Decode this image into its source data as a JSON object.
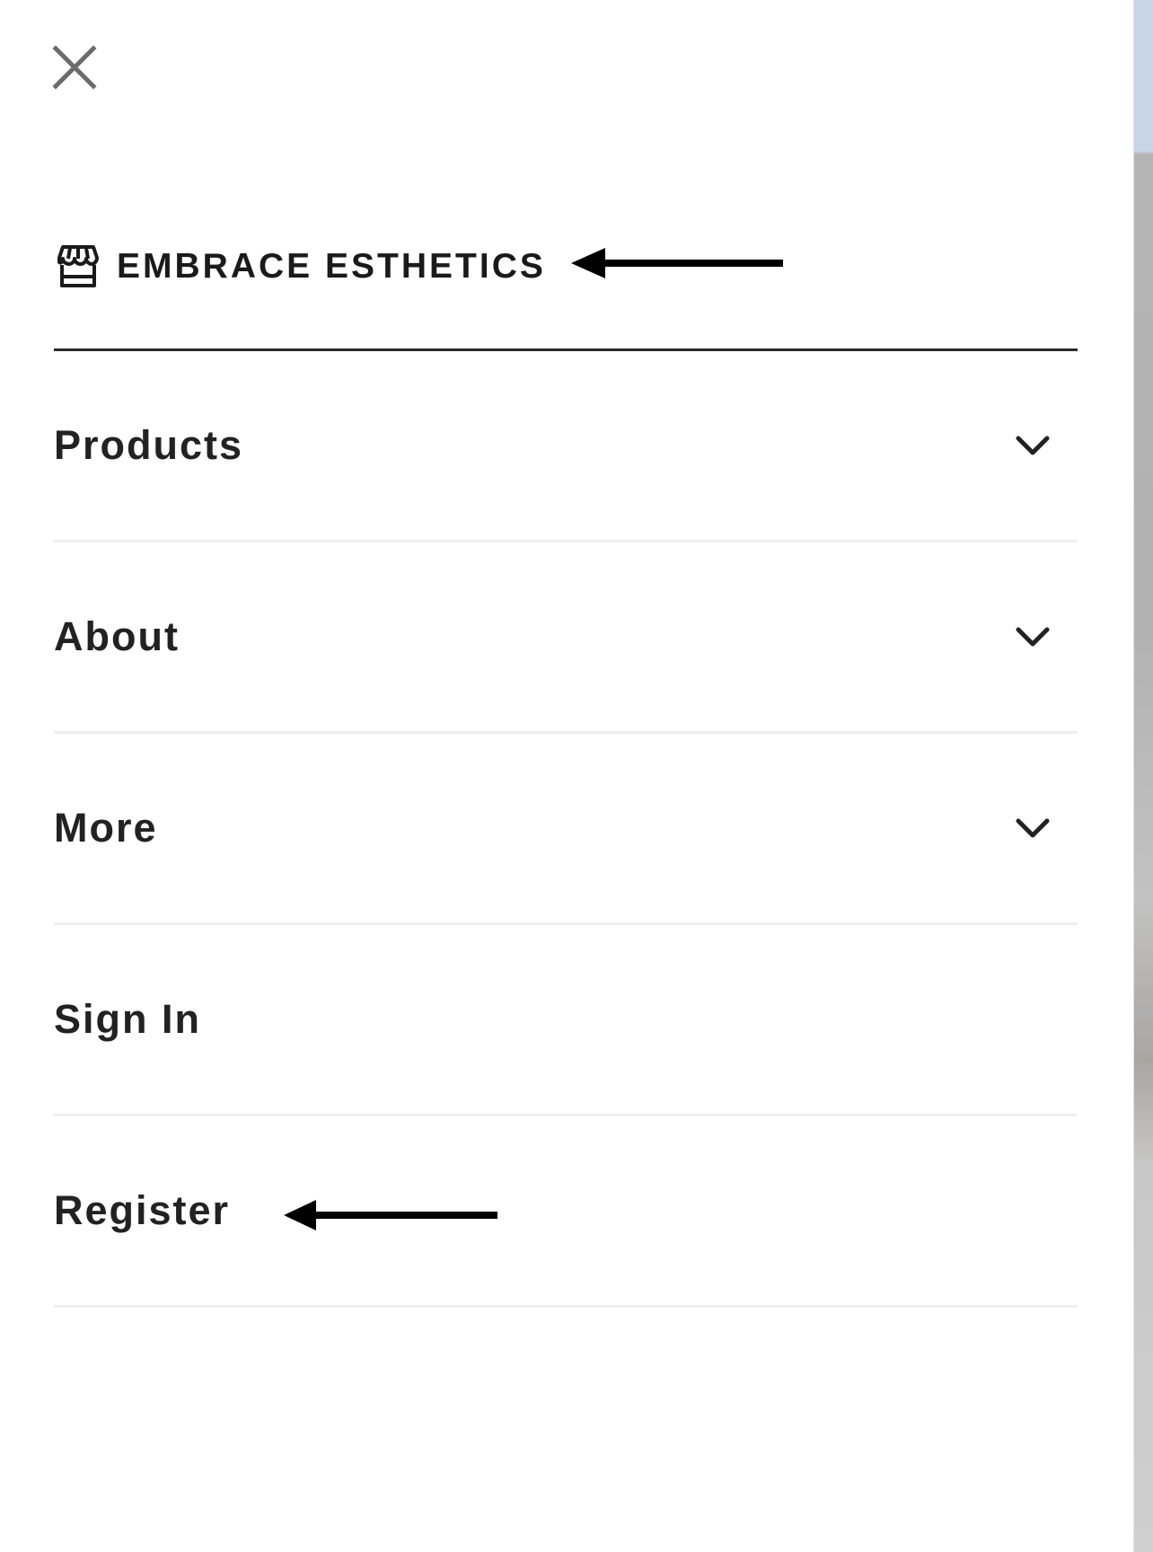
{
  "menu": {
    "close_icon": "close-icon",
    "store": {
      "label": "EMBRACE ESTHETICS",
      "icon": "storefront-icon"
    },
    "items": [
      {
        "label": "Products",
        "expandable": true,
        "icon": "chevron-down-icon"
      },
      {
        "label": "About",
        "expandable": true,
        "icon": "chevron-down-icon"
      },
      {
        "label": "More",
        "expandable": true,
        "icon": "chevron-down-icon"
      },
      {
        "label": "Sign In",
        "expandable": false
      },
      {
        "label": "Register",
        "expandable": false
      }
    ]
  },
  "annotations": {
    "arrow_icon": "left-arrow-icon",
    "arrow_color": "#000000"
  },
  "colors": {
    "text": "#222222",
    "divider_strong": "#2a2a2a",
    "divider_light": "#eeeeee",
    "background": "#ffffff"
  }
}
